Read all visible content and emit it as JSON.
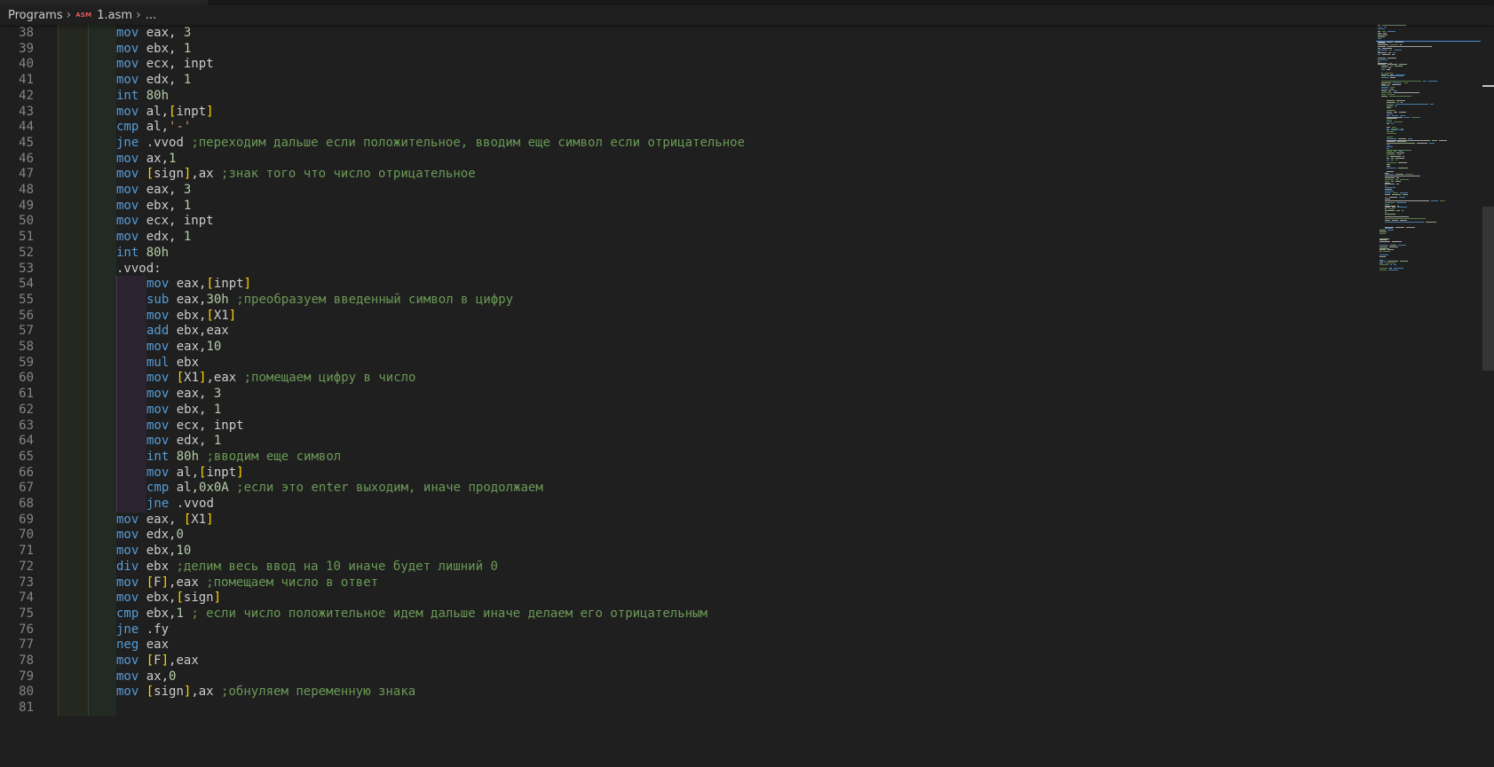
{
  "breadcrumb": {
    "folder": "Programs",
    "file_icon": "ASM",
    "file": "1.asm",
    "more": "..."
  },
  "editor": {
    "lines": [
      {
        "n": "38",
        "indent": 1,
        "tokens": [
          [
            "kw",
            "mov"
          ],
          [
            "txt",
            " eax, "
          ],
          [
            "num",
            "3"
          ]
        ]
      },
      {
        "n": "39",
        "indent": 1,
        "tokens": [
          [
            "kw",
            "mov"
          ],
          [
            "txt",
            " ebx, "
          ],
          [
            "num",
            "1"
          ]
        ]
      },
      {
        "n": "40",
        "indent": 1,
        "tokens": [
          [
            "kw",
            "mov"
          ],
          [
            "txt",
            " ecx, inpt"
          ]
        ]
      },
      {
        "n": "41",
        "indent": 1,
        "tokens": [
          [
            "kw",
            "mov"
          ],
          [
            "txt",
            " edx, "
          ],
          [
            "num",
            "1"
          ]
        ]
      },
      {
        "n": "42",
        "indent": 1,
        "tokens": [
          [
            "kw",
            "int"
          ],
          [
            "txt",
            " "
          ],
          [
            "num",
            "80h"
          ]
        ]
      },
      {
        "n": "43",
        "indent": 1,
        "tokens": [
          [
            "kw",
            "mov"
          ],
          [
            "txt",
            " al,"
          ],
          [
            "br",
            "["
          ],
          [
            "txt",
            "inpt"
          ],
          [
            "br",
            "]"
          ]
        ]
      },
      {
        "n": "44",
        "indent": 1,
        "tokens": [
          [
            "kw",
            "cmp"
          ],
          [
            "txt",
            " al,"
          ],
          [
            "str",
            "'-'"
          ]
        ]
      },
      {
        "n": "45",
        "indent": 1,
        "tokens": [
          [
            "kw",
            "jne"
          ],
          [
            "txt",
            " .vvod "
          ],
          [
            "cmt",
            ";переходим дальше если положительное, вводим еще символ если отрицательное"
          ]
        ]
      },
      {
        "n": "46",
        "indent": 1,
        "tokens": [
          [
            "kw",
            "mov"
          ],
          [
            "txt",
            " ax,"
          ],
          [
            "num",
            "1"
          ]
        ]
      },
      {
        "n": "47",
        "indent": 1,
        "tokens": [
          [
            "kw",
            "mov"
          ],
          [
            "txt",
            " "
          ],
          [
            "br",
            "["
          ],
          [
            "txt",
            "sign"
          ],
          [
            "br",
            "]"
          ],
          [
            "txt",
            ",ax "
          ],
          [
            "cmt",
            ";знак того что число отрицательное"
          ]
        ]
      },
      {
        "n": "48",
        "indent": 1,
        "tokens": [
          [
            "kw",
            "mov"
          ],
          [
            "txt",
            " eax, "
          ],
          [
            "num",
            "3"
          ]
        ]
      },
      {
        "n": "49",
        "indent": 1,
        "tokens": [
          [
            "kw",
            "mov"
          ],
          [
            "txt",
            " ebx, "
          ],
          [
            "num",
            "1"
          ]
        ]
      },
      {
        "n": "50",
        "indent": 1,
        "tokens": [
          [
            "kw",
            "mov"
          ],
          [
            "txt",
            " ecx, inpt"
          ]
        ]
      },
      {
        "n": "51",
        "indent": 1,
        "tokens": [
          [
            "kw",
            "mov"
          ],
          [
            "txt",
            " edx, "
          ],
          [
            "num",
            "1"
          ]
        ]
      },
      {
        "n": "52",
        "indent": 1,
        "tokens": [
          [
            "kw",
            "int"
          ],
          [
            "txt",
            " "
          ],
          [
            "num",
            "80h"
          ]
        ]
      },
      {
        "n": "53",
        "indent": 1,
        "tokens": [
          [
            "txt",
            ".vvod:"
          ]
        ]
      },
      {
        "n": "54",
        "indent": 2,
        "tokens": [
          [
            "kw",
            "mov"
          ],
          [
            "txt",
            " eax,"
          ],
          [
            "br",
            "["
          ],
          [
            "txt",
            "inpt"
          ],
          [
            "br",
            "]"
          ]
        ]
      },
      {
        "n": "55",
        "indent": 2,
        "tokens": [
          [
            "kw",
            "sub"
          ],
          [
            "txt",
            " eax,"
          ],
          [
            "num",
            "30h"
          ],
          [
            "txt",
            " "
          ],
          [
            "cmt",
            ";преобразуем введенный символ в цифру"
          ]
        ]
      },
      {
        "n": "56",
        "indent": 2,
        "tokens": [
          [
            "kw",
            "mov"
          ],
          [
            "txt",
            " ebx,"
          ],
          [
            "br",
            "["
          ],
          [
            "txt",
            "X1"
          ],
          [
            "br",
            "]"
          ]
        ]
      },
      {
        "n": "57",
        "indent": 2,
        "tokens": [
          [
            "kw",
            "add"
          ],
          [
            "txt",
            " ebx,eax"
          ]
        ]
      },
      {
        "n": "58",
        "indent": 2,
        "tokens": [
          [
            "kw",
            "mov"
          ],
          [
            "txt",
            " eax,"
          ],
          [
            "num",
            "10"
          ]
        ]
      },
      {
        "n": "59",
        "indent": 2,
        "tokens": [
          [
            "kw",
            "mul"
          ],
          [
            "txt",
            " ebx"
          ]
        ]
      },
      {
        "n": "60",
        "indent": 2,
        "tokens": [
          [
            "kw",
            "mov"
          ],
          [
            "txt",
            " "
          ],
          [
            "br",
            "["
          ],
          [
            "txt",
            "X1"
          ],
          [
            "br",
            "]"
          ],
          [
            "txt",
            ",eax "
          ],
          [
            "cmt",
            ";помещаем цифру в число"
          ]
        ]
      },
      {
        "n": "61",
        "indent": 2,
        "tokens": [
          [
            "kw",
            "mov"
          ],
          [
            "txt",
            " eax, "
          ],
          [
            "num",
            "3"
          ]
        ]
      },
      {
        "n": "62",
        "indent": 2,
        "tokens": [
          [
            "kw",
            "mov"
          ],
          [
            "txt",
            " ebx, "
          ],
          [
            "num",
            "1"
          ]
        ]
      },
      {
        "n": "63",
        "indent": 2,
        "tokens": [
          [
            "kw",
            "mov"
          ],
          [
            "txt",
            " ecx, inpt"
          ]
        ]
      },
      {
        "n": "64",
        "indent": 2,
        "tokens": [
          [
            "kw",
            "mov"
          ],
          [
            "txt",
            " edx, "
          ],
          [
            "num",
            "1"
          ]
        ]
      },
      {
        "n": "65",
        "indent": 2,
        "tokens": [
          [
            "kw",
            "int"
          ],
          [
            "txt",
            " "
          ],
          [
            "num",
            "80h"
          ],
          [
            "txt",
            " "
          ],
          [
            "cmt",
            ";вводим еще символ"
          ]
        ]
      },
      {
        "n": "66",
        "indent": 2,
        "tokens": [
          [
            "kw",
            "mov"
          ],
          [
            "txt",
            " al,"
          ],
          [
            "br",
            "["
          ],
          [
            "txt",
            "inpt"
          ],
          [
            "br",
            "]"
          ]
        ]
      },
      {
        "n": "67",
        "indent": 2,
        "tokens": [
          [
            "kw",
            "cmp"
          ],
          [
            "txt",
            " al,"
          ],
          [
            "num",
            "0x0A"
          ],
          [
            "txt",
            " "
          ],
          [
            "cmt",
            ";если это enter выходим, иначе продолжаем"
          ]
        ]
      },
      {
        "n": "68",
        "indent": 2,
        "tokens": [
          [
            "kw",
            "jne"
          ],
          [
            "txt",
            " .vvod"
          ]
        ]
      },
      {
        "n": "69",
        "indent": 1,
        "tokens": [
          [
            "kw",
            "mov"
          ],
          [
            "txt",
            " eax, "
          ],
          [
            "br",
            "["
          ],
          [
            "txt",
            "X1"
          ],
          [
            "br",
            "]"
          ]
        ]
      },
      {
        "n": "70",
        "indent": 1,
        "tokens": [
          [
            "kw",
            "mov"
          ],
          [
            "txt",
            " edx,"
          ],
          [
            "num",
            "0"
          ]
        ]
      },
      {
        "n": "71",
        "indent": 1,
        "tokens": [
          [
            "kw",
            "mov"
          ],
          [
            "txt",
            " ebx,"
          ],
          [
            "num",
            "10"
          ]
        ]
      },
      {
        "n": "72",
        "indent": 1,
        "tokens": [
          [
            "kw",
            "div"
          ],
          [
            "txt",
            " ebx "
          ],
          [
            "cmt",
            ";делим весь ввод на 10 иначе будет лишний 0"
          ]
        ]
      },
      {
        "n": "73",
        "indent": 1,
        "tokens": [
          [
            "kw",
            "mov"
          ],
          [
            "txt",
            " "
          ],
          [
            "br",
            "["
          ],
          [
            "txt",
            "F"
          ],
          [
            "br",
            "]"
          ],
          [
            "txt",
            ",eax "
          ],
          [
            "cmt",
            ";помещаем число в ответ"
          ]
        ]
      },
      {
        "n": "74",
        "indent": 1,
        "tokens": [
          [
            "kw",
            "mov"
          ],
          [
            "txt",
            " ebx,"
          ],
          [
            "br",
            "["
          ],
          [
            "txt",
            "sign"
          ],
          [
            "br",
            "]"
          ]
        ]
      },
      {
        "n": "75",
        "indent": 1,
        "tokens": [
          [
            "kw",
            "cmp"
          ],
          [
            "txt",
            " ebx,"
          ],
          [
            "num",
            "1"
          ],
          [
            "txt",
            " "
          ],
          [
            "cmt",
            "; если число положительное идем дальше иначе делаем его отрицательным"
          ]
        ]
      },
      {
        "n": "76",
        "indent": 1,
        "tokens": [
          [
            "kw",
            "jne"
          ],
          [
            "txt",
            " .fy"
          ]
        ]
      },
      {
        "n": "77",
        "indent": 1,
        "tokens": [
          [
            "kw",
            "neg"
          ],
          [
            "txt",
            " eax"
          ]
        ]
      },
      {
        "n": "78",
        "indent": 1,
        "tokens": [
          [
            "kw",
            "mov"
          ],
          [
            "txt",
            " "
          ],
          [
            "br",
            "["
          ],
          [
            "txt",
            "F"
          ],
          [
            "br",
            "]"
          ],
          [
            "txt",
            ",eax"
          ]
        ]
      },
      {
        "n": "79",
        "indent": 1,
        "tokens": [
          [
            "kw",
            "mov"
          ],
          [
            "txt",
            " ax,"
          ],
          [
            "num",
            "0"
          ]
        ]
      },
      {
        "n": "80",
        "indent": 1,
        "tokens": [
          [
            "kw",
            "mov"
          ],
          [
            "txt",
            " "
          ],
          [
            "br",
            "["
          ],
          [
            "txt",
            "sign"
          ],
          [
            "br",
            "]"
          ],
          [
            "txt",
            ",ax "
          ],
          [
            "cmt",
            ";обнуляем переменную знака"
          ]
        ]
      },
      {
        "n": "81",
        "indent": 0,
        "tokens": []
      }
    ]
  },
  "colors": {
    "background": "#1f1f1f",
    "keyword": "#569cd6",
    "number": "#b5cea8",
    "string": "#ce9178",
    "comment": "#6a9955",
    "bracket": "#ffd700",
    "text": "#cccccc",
    "line_number": "#858585"
  }
}
